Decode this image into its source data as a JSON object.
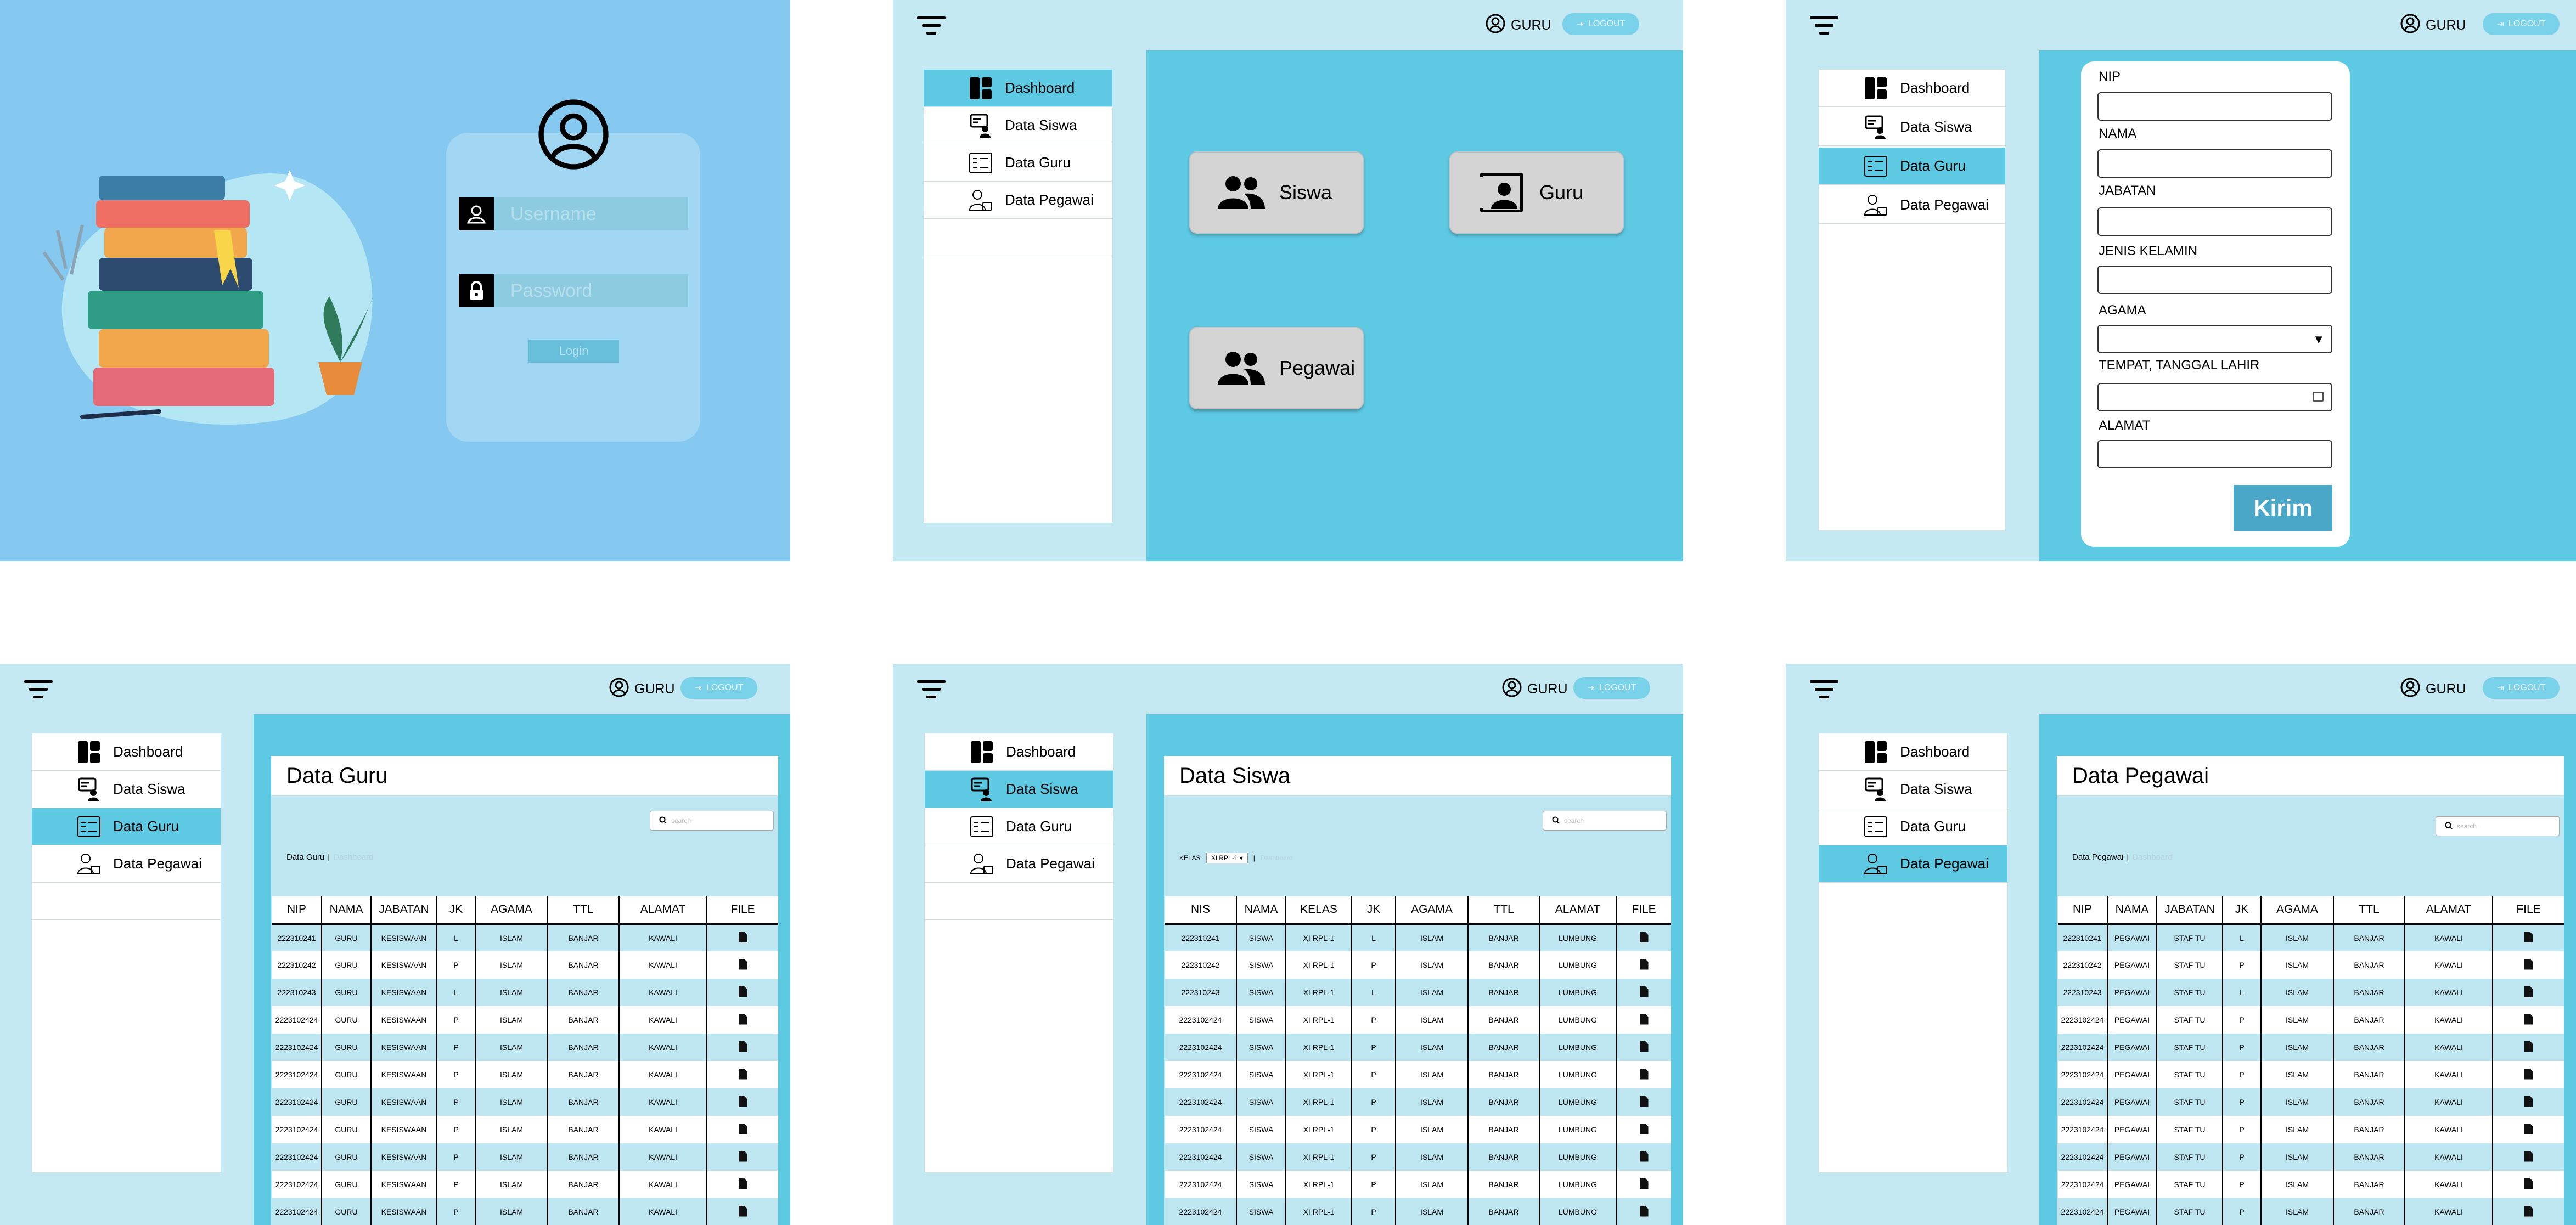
{
  "login": {
    "username_placeholder": "Username",
    "password_placeholder": "Password",
    "login_label": "Login"
  },
  "header": {
    "user_label": "GURU",
    "logout_label": "LOGOUT"
  },
  "sidebar": {
    "items": [
      {
        "label": "Dashboard"
      },
      {
        "label": "Data Siswa"
      },
      {
        "label": "Data Guru"
      },
      {
        "label": "Data Pegawai"
      }
    ]
  },
  "dashboard": {
    "cards": [
      {
        "label": "Siswa"
      },
      {
        "label": "Guru"
      },
      {
        "label": "Pegawai"
      }
    ]
  },
  "form": {
    "labels": [
      "NIP",
      "NAMA",
      "JABATAN",
      "JENIS KELAMIN",
      "AGAMA",
      "TEMPAT, TANGGAL LAHIR",
      "ALAMAT"
    ],
    "submit_label": "Kirim"
  },
  "tables": {
    "search_placeholder": "search",
    "crumb_dashboard": "Dashboard",
    "guru": {
      "title": "Data Guru",
      "crumb": "Data Guru",
      "columns": [
        "NIP",
        "NAMA",
        "JABATAN",
        "JK",
        "AGAMA",
        "TTL",
        "ALAMAT",
        "FILE"
      ],
      "rows": [
        [
          "222310241",
          "GURU",
          "KESISWAAN",
          "L",
          "ISLAM",
          "BANJAR",
          "KAWALI"
        ],
        [
          "222310242",
          "GURU",
          "KESISWAAN",
          "P",
          "ISLAM",
          "BANJAR",
          "KAWALI"
        ],
        [
          "222310243",
          "GURU",
          "KESISWAAN",
          "L",
          "ISLAM",
          "BANJAR",
          "KAWALI"
        ],
        [
          "2223102424",
          "GURU",
          "KESISWAAN",
          "P",
          "ISLAM",
          "BANJAR",
          "KAWALI"
        ],
        [
          "2223102424",
          "GURU",
          "KESISWAAN",
          "P",
          "ISLAM",
          "BANJAR",
          "KAWALI"
        ],
        [
          "2223102424",
          "GURU",
          "KESISWAAN",
          "P",
          "ISLAM",
          "BANJAR",
          "KAWALI"
        ],
        [
          "2223102424",
          "GURU",
          "KESISWAAN",
          "P",
          "ISLAM",
          "BANJAR",
          "KAWALI"
        ],
        [
          "2223102424",
          "GURU",
          "KESISWAAN",
          "P",
          "ISLAM",
          "BANJAR",
          "KAWALI"
        ],
        [
          "2223102424",
          "GURU",
          "KESISWAAN",
          "P",
          "ISLAM",
          "BANJAR",
          "KAWALI"
        ],
        [
          "2223102424",
          "GURU",
          "KESISWAAN",
          "P",
          "ISLAM",
          "BANJAR",
          "KAWALI"
        ],
        [
          "2223102424",
          "GURU",
          "KESISWAAN",
          "P",
          "ISLAM",
          "BANJAR",
          "KAWALI"
        ]
      ]
    },
    "siswa": {
      "title": "Data Siswa",
      "kelas_label": "KELAS",
      "kelas_value": "XI RPL-1",
      "columns": [
        "NIS",
        "NAMA",
        "KELAS",
        "JK",
        "AGAMA",
        "TTL",
        "ALAMAT",
        "FILE"
      ],
      "rows": [
        [
          "222310241",
          "SISWA",
          "XI RPL-1",
          "L",
          "ISLAM",
          "BANJAR",
          "LUMBUNG"
        ],
        [
          "222310242",
          "SISWA",
          "XI RPL-1",
          "P",
          "ISLAM",
          "BANJAR",
          "LUMBUNG"
        ],
        [
          "222310243",
          "SISWA",
          "XI RPL-1",
          "L",
          "ISLAM",
          "BANJAR",
          "LUMBUNG"
        ],
        [
          "2223102424",
          "SISWA",
          "XI RPL-1",
          "P",
          "ISLAM",
          "BANJAR",
          "LUMBUNG"
        ],
        [
          "2223102424",
          "SISWA",
          "XI RPL-1",
          "P",
          "ISLAM",
          "BANJAR",
          "LUMBUNG"
        ],
        [
          "2223102424",
          "SISWA",
          "XI RPL-1",
          "P",
          "ISLAM",
          "BANJAR",
          "LUMBUNG"
        ],
        [
          "2223102424",
          "SISWA",
          "XI RPL-1",
          "P",
          "ISLAM",
          "BANJAR",
          "LUMBUNG"
        ],
        [
          "2223102424",
          "SISWA",
          "XI RPL-1",
          "P",
          "ISLAM",
          "BANJAR",
          "LUMBUNG"
        ],
        [
          "2223102424",
          "SISWA",
          "XI RPL-1",
          "P",
          "ISLAM",
          "BANJAR",
          "LUMBUNG"
        ],
        [
          "2223102424",
          "SISWA",
          "XI RPL-1",
          "P",
          "ISLAM",
          "BANJAR",
          "LUMBUNG"
        ],
        [
          "2223102424",
          "SISWA",
          "XI RPL-1",
          "P",
          "ISLAM",
          "BANJAR",
          "LUMBUNG"
        ]
      ]
    },
    "pegawai": {
      "title": "Data Pegawai",
      "crumb": "Data Pegawai",
      "columns": [
        "NIP",
        "NAMA",
        "JABATAN",
        "JK",
        "AGAMA",
        "TTL",
        "ALAMAT",
        "FILE"
      ],
      "rows": [
        [
          "222310241",
          "PEGAWAI",
          "STAF TU",
          "L",
          "ISLAM",
          "BANJAR",
          "KAWALI"
        ],
        [
          "222310242",
          "PEGAWAI",
          "STAF TU",
          "P",
          "ISLAM",
          "BANJAR",
          "KAWALI"
        ],
        [
          "222310243",
          "PEGAWAI",
          "STAF TU",
          "L",
          "ISLAM",
          "BANJAR",
          "KAWALI"
        ],
        [
          "2223102424",
          "PEGAWAI",
          "STAF TU",
          "P",
          "ISLAM",
          "BANJAR",
          "KAWALI"
        ],
        [
          "2223102424",
          "PEGAWAI",
          "STAF TU",
          "P",
          "ISLAM",
          "BANJAR",
          "KAWALI"
        ],
        [
          "2223102424",
          "PEGAWAI",
          "STAF TU",
          "P",
          "ISLAM",
          "BANJAR",
          "KAWALI"
        ],
        [
          "2223102424",
          "PEGAWAI",
          "STAF TU",
          "P",
          "ISLAM",
          "BANJAR",
          "KAWALI"
        ],
        [
          "2223102424",
          "PEGAWAI",
          "STAF TU",
          "P",
          "ISLAM",
          "BANJAR",
          "KAWALI"
        ],
        [
          "2223102424",
          "PEGAWAI",
          "STAF TU",
          "P",
          "ISLAM",
          "BANJAR",
          "KAWALI"
        ],
        [
          "2223102424",
          "PEGAWAI",
          "STAF TU",
          "P",
          "ISLAM",
          "BANJAR",
          "KAWALI"
        ],
        [
          "2223102424",
          "PEGAWAI",
          "STAF TU",
          "P",
          "ISLAM",
          "BANJAR",
          "KAWALI"
        ]
      ]
    }
  },
  "colors": {
    "login_bg": "#85c8f0",
    "light_panel": "#c4e9f2",
    "accent": "#5ec9e3",
    "submit": "#4ba7c7"
  },
  "icons": [
    "user-circle-icon",
    "lock-icon",
    "filter-menu-icon",
    "logout-icon",
    "dashboard-icon",
    "student-icon",
    "teacher-icon",
    "employee-icon",
    "people-icon",
    "portrait-icon",
    "search-icon",
    "file-icon",
    "calendar-icon",
    "caret-down-icon"
  ]
}
